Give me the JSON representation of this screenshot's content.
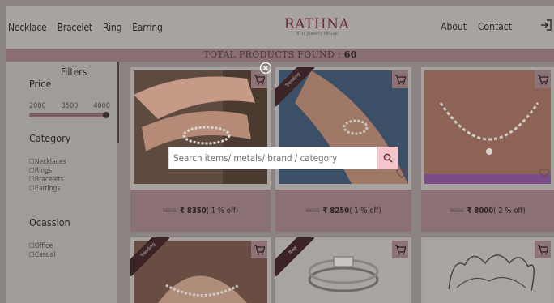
{
  "nav": {
    "left": [
      "Necklace",
      "Bracelet",
      "Ring",
      "Earring"
    ],
    "right": [
      "About",
      "Contact"
    ]
  },
  "logo": {
    "main": "RATHNA",
    "sub": "Your Jewelry House"
  },
  "total": {
    "label": "TOTAL PRODUCTS FOUND :",
    "count": "60"
  },
  "filters": {
    "title": "Filters",
    "price_label": "Price",
    "range_labels": [
      "2000",
      "3500",
      "4000"
    ],
    "price_value_fraction": 0.97,
    "category_label": "Category",
    "categories": [
      "Necklaces",
      "Rings",
      "Bracelets",
      "Earrings"
    ],
    "occasion_label": "Ocassion",
    "occasions": [
      "Office",
      "Casual"
    ]
  },
  "search": {
    "placeholder": "Search items/ metals/ brand / category"
  },
  "products": [
    {
      "old_price": "₹8500",
      "new_price": "₹ 8350",
      "discount": "( 1 % off)",
      "badge": ""
    },
    {
      "old_price": "₹8500",
      "new_price": "₹ 8250",
      "discount": "( 1 % off)",
      "badge": "Trending"
    },
    {
      "old_price": "₹9000",
      "new_price": "₹ 8000",
      "discount": "( 2 % off)",
      "badge": ""
    },
    {
      "old_price": "",
      "new_price": "",
      "discount": "",
      "badge": "Trending"
    },
    {
      "old_price": "",
      "new_price": "",
      "discount": "",
      "badge": "New"
    },
    {
      "old_price": "",
      "new_price": "",
      "discount": "",
      "badge": ""
    }
  ],
  "colors": {
    "accent": "#f2c6cc",
    "brand": "#6b2d3c",
    "footer": "#8c7174",
    "ribbon": "#3c2326"
  }
}
